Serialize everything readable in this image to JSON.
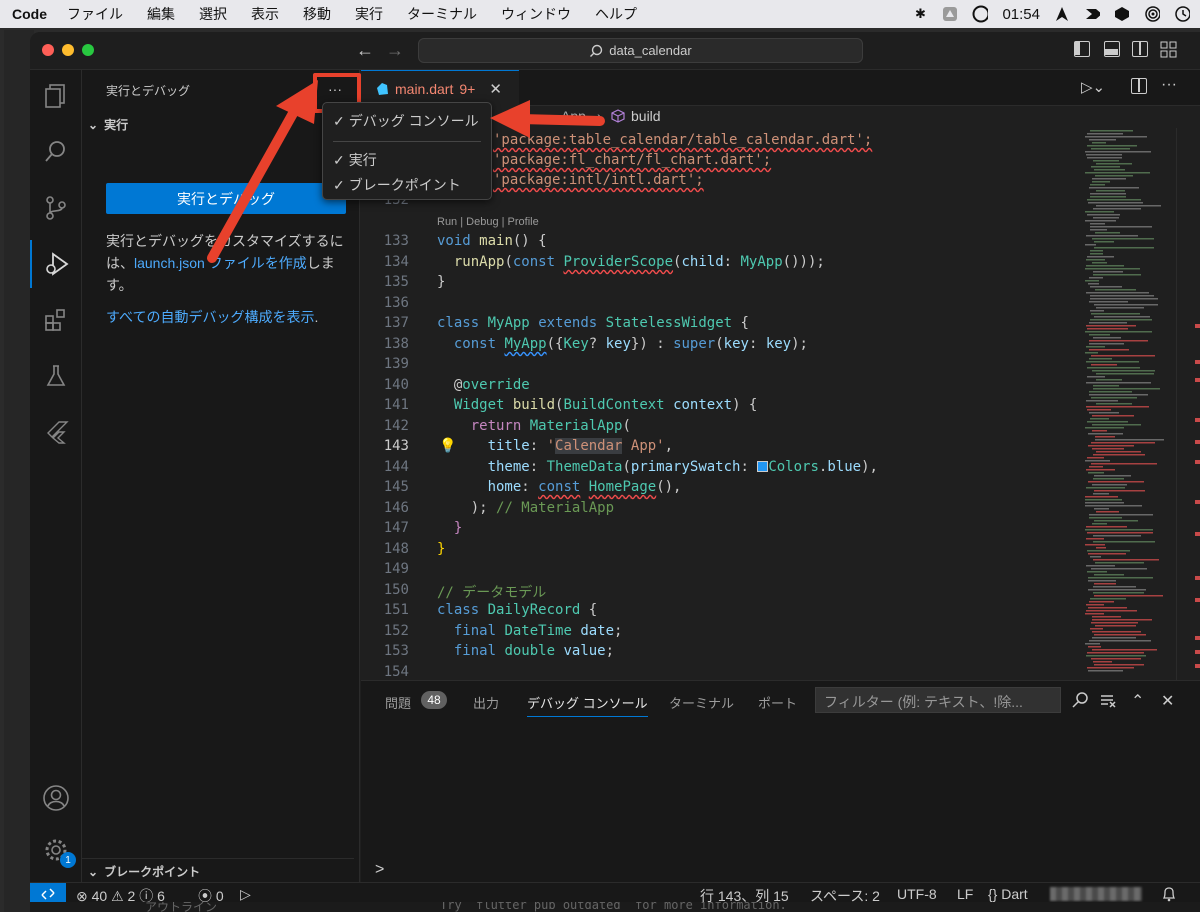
{
  "menubar": {
    "app": "Code",
    "items": [
      "ファイル",
      "編集",
      "選択",
      "表示",
      "移動",
      "実行",
      "ターミナル",
      "ウィンドウ",
      "ヘルプ"
    ],
    "time": "01:54"
  },
  "titlebar": {
    "search": "data_calendar"
  },
  "sidebar": {
    "title": "実行とデバッグ",
    "more": "···",
    "run_section": "実行",
    "run_button": "実行とデバッグ",
    "text_before": "実行とデバッグをカスタマイズするには、",
    "text_link": "launch.json ファイルを作成",
    "text_after": "します。",
    "auto_link": "すべての自動デバッグ構成を表示",
    "auto_after": ".",
    "breakpoints_section": "ブレークポイント",
    "settings_badge": "1"
  },
  "dropdown": {
    "items": [
      {
        "check": "✓",
        "label": "デバッグ コンソール"
      },
      {
        "check": "✓",
        "label": "実行"
      },
      {
        "check": "✓",
        "label": "ブレークポイント"
      }
    ]
  },
  "editor": {
    "tab_name": "main.dart",
    "tab_count": "9+",
    "breadcrumb_partial": "App",
    "breadcrumb_build": "build",
    "codelens": "Run | Debug | Profile",
    "lines": [
      "132",
      "133",
      "134",
      "135",
      "136",
      "137",
      "138",
      "139",
      "140",
      "141",
      "142",
      "143",
      "144",
      "145",
      "146",
      "147",
      "148",
      "149",
      "150",
      "151",
      "152",
      "153",
      "154"
    ],
    "imports": [
      "'package:table_calendar/table_calendar.dart';",
      "'package:fl_chart/fl_chart.dart';",
      "'package:intl/intl.dart';"
    ],
    "comment_material": "// MaterialApp",
    "comment_datamodel": "// データモデル"
  },
  "panel": {
    "tabs": [
      "問題",
      "出力",
      "デバッグ コンソール",
      "ターミナル",
      "ポート"
    ],
    "problems_count": "48",
    "filter_placeholder": "フィルター (例: テキスト、!除...",
    "prompt": ">"
  },
  "statusbar": {
    "errors": "40",
    "warnings": "2",
    "info": "6",
    "ports": "0",
    "position": "行 143、列 15",
    "spaces": "スペース: 2",
    "encoding": "UTF-8",
    "eol": "LF",
    "language": "Dart"
  },
  "background_window": {
    "outline_label": "アウトライン",
    "terminal_text": "Try `flutter pub outdated` for more information."
  }
}
